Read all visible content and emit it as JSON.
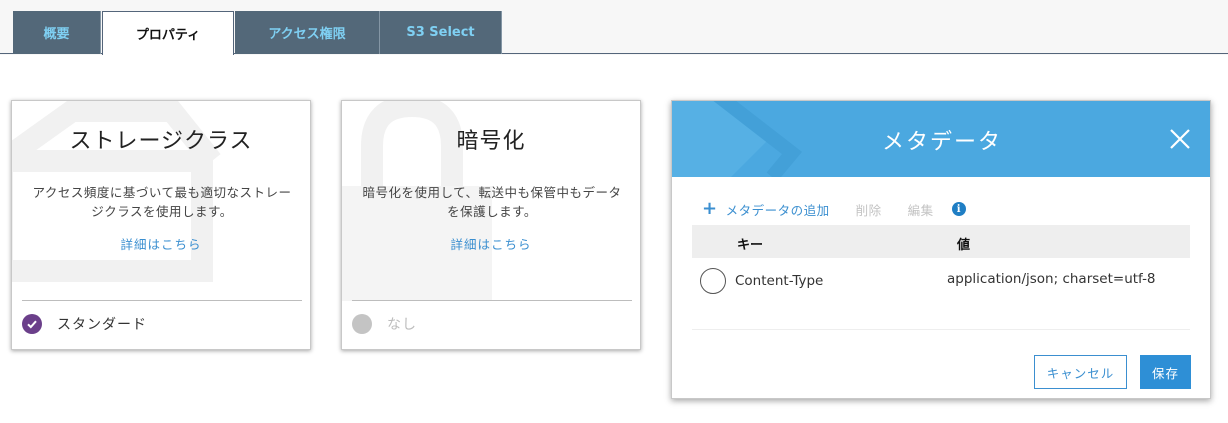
{
  "tabs": [
    {
      "label": "概要",
      "active": false
    },
    {
      "label": "プロパティ",
      "active": true
    },
    {
      "label": "アクセス権限",
      "active": false
    },
    {
      "label": "S3 Select",
      "active": false
    }
  ],
  "cards": {
    "storage": {
      "title": "ストレージクラス",
      "description": "アクセス頻度に基づいて最も適切なストレージクラスを使用します。",
      "link": "詳細はこちら",
      "status": "スタンダード",
      "status_icon": "check-circle-icon"
    },
    "encryption": {
      "title": "暗号化",
      "description": "暗号化を使用して、転送中も保管中もデータを保護します。",
      "link": "詳細はこちら",
      "status": "なし",
      "status_icon": "gray-dot-icon"
    }
  },
  "modal": {
    "title": "メタデータ",
    "toolbar": {
      "add": "メタデータの追加",
      "delete": "削除",
      "edit": "編集"
    },
    "table": {
      "headers": {
        "key": "キー",
        "value": "値"
      },
      "rows": [
        {
          "key": "Content-Type",
          "value": "application/json; charset=utf-8"
        }
      ]
    },
    "buttons": {
      "cancel": "キャンセル",
      "save": "保存"
    }
  },
  "colors": {
    "tab_inactive_bg": "#536879",
    "tab_inactive_text": "#7fd0f3",
    "link": "#3b8fd0",
    "modal_header": "#4ba8e0",
    "check_purple": "#6b3f8a",
    "save_button": "#2e8fd6"
  }
}
